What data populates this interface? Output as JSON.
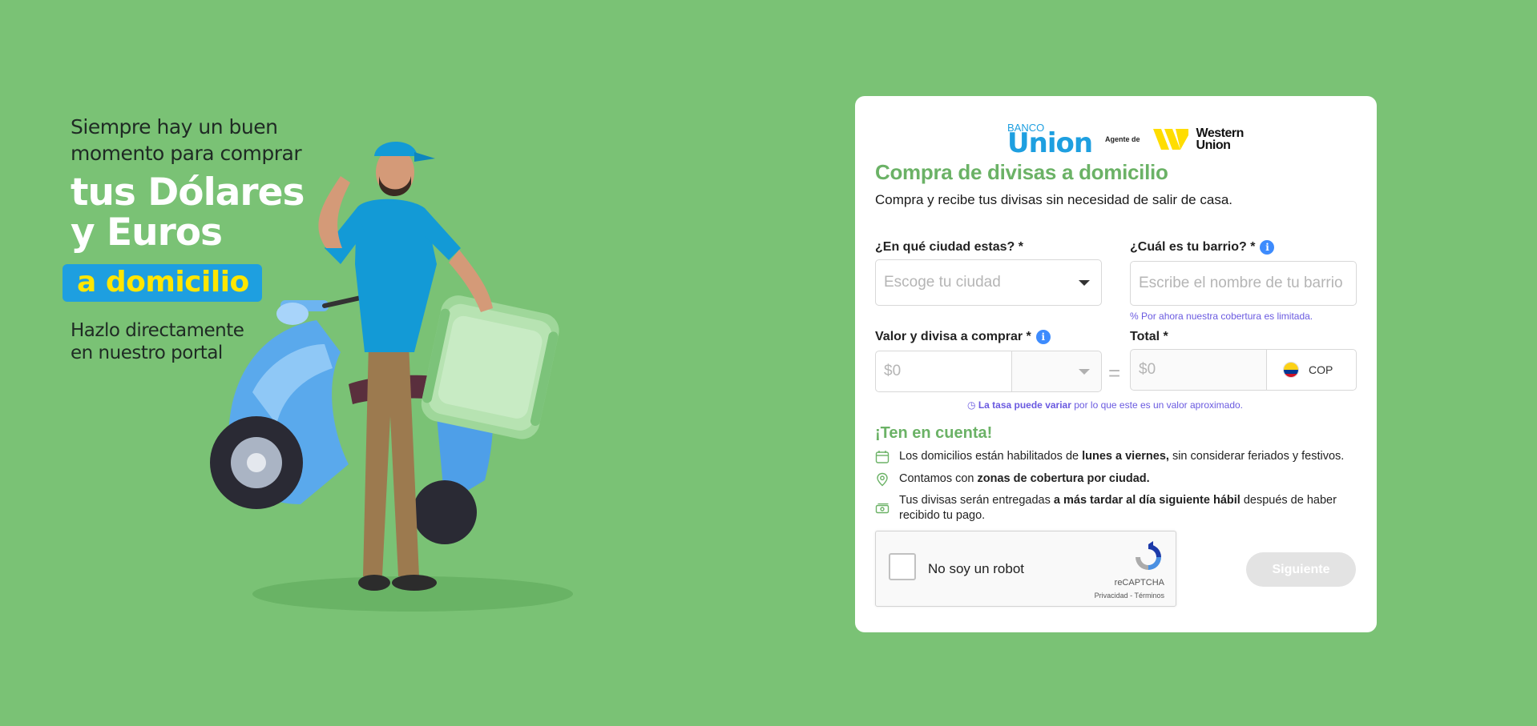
{
  "hero": {
    "line1": "Siempre hay un buen",
    "line2": "momento para comprar",
    "big1": "tus Dólares",
    "big2": "y Euros",
    "pill": "a domicilio",
    "sub1": "Hazlo directamente",
    "sub2": "en nuestro portal"
  },
  "brand": {
    "banco_small": "BANCO",
    "banco_big": "Union",
    "agente": "Agente de",
    "wu_line1": "Western",
    "wu_line2": "Union"
  },
  "form": {
    "title": "Compra de divisas a domicilio",
    "subtitle": "Compra y recibe tus divisas sin necesidad de salir de casa.",
    "city_label": "¿En qué ciudad estas? *",
    "city_placeholder": "Escoge tu ciudad",
    "barrio_label": "¿Cuál es tu barrio? *",
    "barrio_placeholder": "Escribe el nombre de tu barrio",
    "coverage_note": "Por ahora nuestra cobertura es limitada.",
    "value_label": "Valor y divisa a comprar *",
    "value_placeholder": "$0",
    "total_label": "Total *",
    "total_placeholder": "$0",
    "currency": "COP",
    "equals": "=",
    "rate_note_bold": "La tasa puede variar",
    "rate_note_rest": " por lo que este es un valor aproximado."
  },
  "tener": {
    "title": "¡Ten en cuenta!",
    "b1_pre": "Los domicilios están habilitados de ",
    "b1_bold": "lunes a viernes,",
    "b1_post": " sin considerar feriados y festivos.",
    "b2_pre": "Contamos con ",
    "b2_bold": "zonas de cobertura por ciudad.",
    "b3_pre": "Tus divisas serán entregadas ",
    "b3_bold": "a más tardar al día siguiente hábil",
    "b3_post": " después de haber recibido tu pago."
  },
  "captcha": {
    "label": "No soy un robot",
    "brand": "reCAPTCHA",
    "links": "Privacidad - Términos"
  },
  "actions": {
    "next": "Siguiente"
  },
  "colors": {
    "background": "#7ac275",
    "accent_green": "#6bb266",
    "brand_blue": "#1e9fe0",
    "pill_yellow": "#ffe600",
    "note_purple": "#6a5ae0"
  }
}
